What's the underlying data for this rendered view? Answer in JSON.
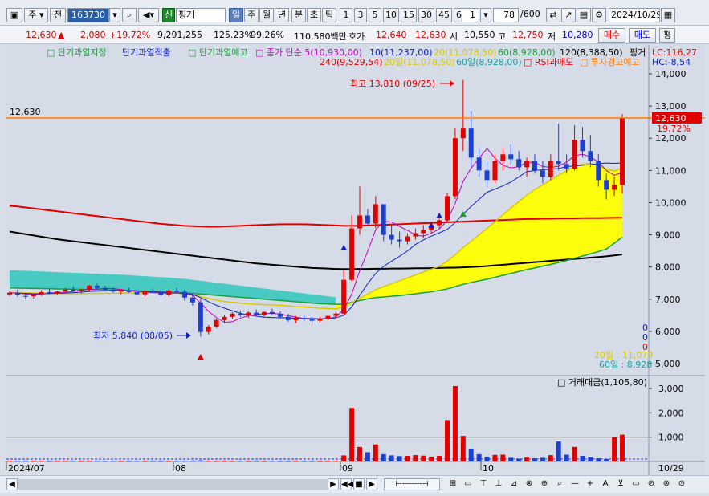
{
  "toolbar": {
    "period_label": "주",
    "prev_label": "전",
    "code": "163730",
    "search_icon": "magnifier",
    "sound_icon": "speaker",
    "new_label": "신",
    "stock_name": "핑거",
    "tf_day": "일",
    "tf_week": "주",
    "tf_month": "월",
    "tf_year": "년",
    "tf_minute": "분",
    "tf_second": "초",
    "tf_tick": "틱",
    "intervals": [
      "1",
      "3",
      "5",
      "10",
      "15",
      "30",
      "45",
      "60"
    ],
    "interval_value": "1",
    "count_value": "78",
    "count_total": "/600",
    "date": "2024/10/29"
  },
  "quote": {
    "price": "12,630",
    "up_arrow": "▲",
    "change": "2,080",
    "change_pct": "+19.72%",
    "volume": "9,291,255",
    "volume_ratio": "125.23%",
    "pct2": "99.26%",
    "amount": "110,580백만",
    "bid_label": "호가",
    "ask_price": "12,640",
    "bid_price": "12,630",
    "open_label": "시",
    "open": "10,550",
    "high_label": "고",
    "high": "12,750",
    "low_label": "저",
    "low": "10,280",
    "buy_label": "매수",
    "sell_label": "매도",
    "eval_label": "평"
  },
  "legend": {
    "l1": "단기과열지정",
    "l2": "단기과열적출",
    "l3": "단기과열예고",
    "l4": "종가 단순 5(10,930,00)",
    "l5": "10(11,237,00)",
    "l6": "20(11,078,50)",
    "l7": "60(8,928,00)",
    "l8": "120(8,388,50)",
    "l9": "핑거",
    "l10": "240(9,529,54)",
    "l11": "20일(11,078,50)",
    "l12": "60일(8,928,00)",
    "l13": "RSI과매도",
    "l14": "투자경고예고",
    "lc": "LC:116,27",
    "hc": "HC:-8,54"
  },
  "annotations": {
    "high": "최고 13,810 (09/25)",
    "low": "최저 5,840 (08/05)",
    "price_line": "12,630",
    "price_tag": "12,630",
    "pct_tag": "19,72%",
    "label_20": "20일 : 11,079",
    "label_60": "60일 : 8,928",
    "zeros": [
      "0",
      "0",
      "0"
    ]
  },
  "price_axis": [
    "14,000",
    "13,000",
    "12,000",
    "11,000",
    "10,000",
    "9,000",
    "8,000",
    "7,000",
    "6,000",
    "5,000"
  ],
  "volume_title": "거래대금(1,105,80)",
  "volume_axis": [
    "3,000",
    "2,000",
    "1,000"
  ],
  "date_axis": [
    "2024/07",
    "08",
    "09",
    "10",
    "10/29"
  ],
  "colors": {
    "up": "#e00000",
    "down": "#1c3fd0",
    "ma240": "#e00000",
    "ma120": "#000000",
    "ma60": "#18a040",
    "ma20": "#f0e000",
    "cloud": "#40c8c0",
    "price_line": "#ff7a00",
    "bg": "#d6dce7"
  },
  "chart_data": {
    "type": "candlestick",
    "candles": [
      [
        7150,
        7250,
        7100,
        7200
      ],
      [
        7200,
        7300,
        7080,
        7120
      ],
      [
        7100,
        7200,
        7000,
        7080
      ],
      [
        7090,
        7180,
        7020,
        7150
      ],
      [
        7150,
        7280,
        7100,
        7220
      ],
      [
        7220,
        7320,
        7150,
        7170
      ],
      [
        7170,
        7260,
        7120,
        7240
      ],
      [
        7240,
        7350,
        7200,
        7300
      ],
      [
        7300,
        7400,
        7220,
        7260
      ],
      [
        7260,
        7330,
        7180,
        7300
      ],
      [
        7300,
        7450,
        7250,
        7420
      ],
      [
        7420,
        7480,
        7300,
        7350
      ],
      [
        7350,
        7420,
        7260,
        7300
      ],
      [
        7300,
        7360,
        7200,
        7240
      ],
      [
        7240,
        7320,
        7150,
        7280
      ],
      [
        7280,
        7350,
        7200,
        7220
      ],
      [
        7220,
        7300,
        7120,
        7150
      ],
      [
        7150,
        7280,
        7100,
        7250
      ],
      [
        7250,
        7330,
        7180,
        7200
      ],
      [
        7200,
        7280,
        7100,
        7120
      ],
      [
        7120,
        7300,
        7080,
        7270
      ],
      [
        7270,
        7350,
        7200,
        7230
      ],
      [
        7230,
        7300,
        6950,
        7050
      ],
      [
        7050,
        7150,
        6800,
        6900
      ],
      [
        6900,
        7000,
        5840,
        5980
      ],
      [
        5980,
        6200,
        5900,
        6150
      ],
      [
        6150,
        6400,
        6100,
        6350
      ],
      [
        6350,
        6500,
        6250,
        6450
      ],
      [
        6450,
        6600,
        6380,
        6550
      ],
      [
        6550,
        6650,
        6450,
        6500
      ],
      [
        6500,
        6620,
        6420,
        6580
      ],
      [
        6580,
        6680,
        6480,
        6520
      ],
      [
        6520,
        6620,
        6450,
        6600
      ],
      [
        6600,
        6700,
        6500,
        6550
      ],
      [
        6550,
        6620,
        6400,
        6450
      ],
      [
        6450,
        6550,
        6300,
        6350
      ],
      [
        6350,
        6480,
        6250,
        6420
      ],
      [
        6420,
        6520,
        6330,
        6380
      ],
      [
        6380,
        6450,
        6280,
        6330
      ],
      [
        6330,
        6460,
        6270,
        6400
      ],
      [
        6400,
        6520,
        6350,
        6480
      ],
      [
        6480,
        6600,
        6420,
        6550
      ],
      [
        6550,
        7900,
        6550,
        7600
      ],
      [
        7600,
        9600,
        7550,
        9200
      ],
      [
        9200,
        10500,
        9000,
        9600
      ],
      [
        9600,
        9800,
        9300,
        9350
      ],
      [
        9350,
        10200,
        9200,
        9950
      ],
      [
        9950,
        9700,
        8800,
        9000
      ],
      [
        9000,
        9300,
        8700,
        8850
      ],
      [
        8850,
        9100,
        8600,
        8800
      ],
      [
        8800,
        9050,
        8700,
        8950
      ],
      [
        8950,
        9200,
        8850,
        9050
      ],
      [
        9050,
        9300,
        8900,
        9150
      ],
      [
        9150,
        9400,
        9050,
        9300
      ],
      [
        9300,
        9500,
        9200,
        9450
      ],
      [
        9450,
        10300,
        9400,
        10200
      ],
      [
        10200,
        12300,
        10100,
        12000
      ],
      [
        12000,
        13810,
        11600,
        12300
      ],
      [
        12300,
        12850,
        11100,
        11400
      ],
      [
        11400,
        11700,
        10800,
        11000
      ],
      [
        11000,
        11300,
        10500,
        10700
      ],
      [
        10700,
        11500,
        10600,
        11300
      ],
      [
        11300,
        11700,
        11000,
        11500
      ],
      [
        11500,
        11800,
        11200,
        11350
      ],
      [
        11350,
        11600,
        11000,
        11100
      ],
      [
        11100,
        11400,
        10800,
        11300
      ],
      [
        11300,
        11500,
        10900,
        11000
      ],
      [
        11000,
        11300,
        10600,
        10800
      ],
      [
        10800,
        11500,
        10700,
        11300
      ],
      [
        11300,
        12450,
        11000,
        11200
      ],
      [
        11200,
        11500,
        10900,
        11050
      ],
      [
        11050,
        12400,
        11000,
        11950
      ],
      [
        11950,
        12350,
        11400,
        11600
      ],
      [
        11600,
        12100,
        11100,
        11300
      ],
      [
        11300,
        11500,
        10500,
        10700
      ],
      [
        10700,
        10900,
        10100,
        10400
      ],
      [
        10400,
        10800,
        10200,
        10550
      ],
      [
        10550,
        12750,
        10280,
        12630
      ]
    ],
    "turnover": [
      30,
      25,
      28,
      22,
      25,
      20,
      22,
      24,
      26,
      21,
      23,
      27,
      22,
      25,
      21,
      19,
      24,
      20,
      23,
      22,
      21,
      25,
      30,
      28,
      45,
      26,
      22,
      24,
      21,
      23,
      20,
      22,
      19,
      24,
      21,
      20,
      25,
      22,
      19,
      20,
      23,
      26,
      250,
      2200,
      600,
      380,
      700,
      300,
      250,
      220,
      230,
      260,
      240,
      200,
      230,
      1700,
      3100,
      1050,
      500,
      300,
      200,
      270,
      280,
      150,
      120,
      160,
      130,
      150,
      260,
      820,
      280,
      600,
      230,
      180,
      130,
      100,
      1000,
      1100
    ],
    "ma240": [
      9900,
      9880,
      9850,
      9820,
      9790,
      9760,
      9730,
      9700,
      9670,
      9640,
      9610,
      9580,
      9550,
      9520,
      9490,
      9460,
      9430,
      9400,
      9370,
      9340,
      9320,
      9300,
      9280,
      9270,
      9260,
      9250,
      9250,
      9260,
      9270,
      9280,
      9290,
      9300,
      9310,
      9320,
      9330,
      9330,
      9330,
      9330,
      9320,
      9310,
      9300,
      9290,
      9280,
      9280,
      9280,
      9290,
      9300,
      9310,
      9320,
      9330,
      9340,
      9350,
      9360,
      9370,
      9380,
      9390,
      9400,
      9410,
      9420,
      9430,
      9440,
      9450,
      9460,
      9470,
      9480,
      9490,
      9490,
      9500,
      9500,
      9510,
      9510,
      9510,
      9520,
      9520,
      9520,
      9525,
      9528,
      9530
    ],
    "ma120": [
      9100,
      9060,
      9020,
      8980,
      8940,
      8900,
      8860,
      8830,
      8800,
      8770,
      8740,
      8710,
      8680,
      8650,
      8620,
      8590,
      8560,
      8530,
      8500,
      8470,
      8440,
      8410,
      8380,
      8350,
      8320,
      8290,
      8260,
      8230,
      8200,
      8170,
      8140,
      8110,
      8090,
      8070,
      8050,
      8030,
      8010,
      7990,
      7970,
      7960,
      7950,
      7940,
      7935,
      7935,
      7940,
      7940,
      7945,
      7945,
      7950,
      7950,
      7955,
      7960,
      7960,
      7965,
      7970,
      7975,
      7980,
      7990,
      8000,
      8010,
      8030,
      8050,
      8070,
      8090,
      8110,
      8130,
      8150,
      8170,
      8190,
      8210,
      8230,
      8250,
      8270,
      8290,
      8310,
      8330,
      8360,
      8390
    ],
    "ma60": [
      7350,
      7345,
      7340,
      7335,
      7330,
      7325,
      7320,
      7315,
      7310,
      7305,
      7300,
      7295,
      7290,
      7285,
      7280,
      7270,
      7260,
      7250,
      7240,
      7230,
      7220,
      7210,
      7200,
      7180,
      7160,
      7140,
      7120,
      7100,
      7080,
      7060,
      7040,
      7020,
      7000,
      6980,
      6960,
      6940,
      6920,
      6900,
      6880,
      6860,
      6850,
      6840,
      6850,
      6900,
      6960,
      7010,
      7050,
      7070,
      7090,
      7110,
      7140,
      7170,
      7200,
      7230,
      7270,
      7320,
      7390,
      7460,
      7520,
      7570,
      7620,
      7680,
      7740,
      7800,
      7860,
      7920,
      7970,
      8030,
      8080,
      8140,
      8200,
      8270,
      8340,
      8410,
      8480,
      8560,
      8740,
      8928
    ],
    "ma20": [
      7200,
      7200,
      7190,
      7190,
      7180,
      7180,
      7175,
      7175,
      7170,
      7170,
      7175,
      7180,
      7180,
      7185,
      7190,
      7190,
      7195,
      7200,
      7200,
      7200,
      7195,
      7190,
      7170,
      7140,
      7080,
      7020,
      6970,
      6930,
      6900,
      6880,
      6860,
      6840,
      6830,
      6820,
      6810,
      6790,
      6770,
      6760,
      6740,
      6720,
      6710,
      6700,
      6760,
      6890,
      7030,
      7160,
      7290,
      7390,
      7480,
      7570,
      7660,
      7750,
      7840,
      7930,
      8020,
      8180,
      8380,
      8600,
      8800,
      9000,
      9200,
      9400,
      9620,
      9830,
      10030,
      10230,
      10400,
      10550,
      10700,
      10850,
      10990,
      11120,
      11200,
      11220,
      11150,
      11050,
      10980,
      11078
    ],
    "ma5": [
      7200,
      7190,
      7160,
      7140,
      7160,
      7190,
      7210,
      7220,
      7240,
      7280,
      7300,
      7320,
      7330,
      7330,
      7300,
      7270,
      7240,
      7220,
      7210,
      7190,
      7180,
      7190,
      7170,
      7120,
      6880,
      6620,
      6430,
      6280,
      6300,
      6410,
      6490,
      6520,
      6550,
      6560,
      6540,
      6490,
      6440,
      6400,
      6380,
      6380,
      6400,
      6450,
      6680,
      7160,
      7880,
      8490,
      9150,
      9420,
      9400,
      9260,
      9140,
      8990,
      8960,
      9050,
      9180,
      9440,
      9980,
      10660,
      11070,
      11380,
      11680,
      11380,
      11160,
      11080,
      11120,
      11250,
      11250,
      11120,
      11100,
      11130,
      11260,
      11460,
      11500,
      11420,
      11260,
      11000,
      10850,
      10930
    ],
    "ma10": [
      7200,
      7190,
      7180,
      7170,
      7170,
      7175,
      7180,
      7190,
      7200,
      7220,
      7240,
      7250,
      7260,
      7270,
      7270,
      7260,
      7250,
      7240,
      7230,
      7220,
      7200,
      7195,
      7180,
      7150,
      7050,
      6920,
      6810,
      6720,
      6640,
      6560,
      6510,
      6470,
      6440,
      6430,
      6420,
      6420,
      6410,
      6400,
      6400,
      6390,
      6400,
      6420,
      6500,
      6760,
      7120,
      7480,
      7800,
      8020,
      8180,
      8330,
      8500,
      8700,
      8840,
      8960,
      9060,
      9170,
      9380,
      9640,
      9880,
      10100,
      10320,
      10420,
      10520,
      10640,
      10800,
      10960,
      11000,
      11020,
      11040,
      11060,
      11120,
      11140,
      11160,
      11180,
      11210,
      11230,
      11220,
      11237
    ],
    "cloud_top": [
      7900,
      7890,
      7880,
      7870,
      7860,
      7850,
      7840,
      7830,
      7820,
      7810,
      7800,
      7790,
      7780,
      7770,
      7760,
      7745,
      7730,
      7715,
      7700,
      7685,
      7670,
      7650,
      7630,
      7600,
      7570,
      7540,
      7510,
      7480,
      7450,
      7420,
      7390,
      7360,
      7330,
      7300,
      7270,
      7240,
      7210,
      7180,
      7150,
      7120,
      7090,
      7060
    ],
    "cloud_bot": [
      7350,
      7345,
      7340,
      7335,
      7330,
      7325,
      7320,
      7315,
      7310,
      7305,
      7300,
      7295,
      7290,
      7285,
      7280,
      7270,
      7260,
      7250,
      7240,
      7230,
      7220,
      7210,
      7200,
      7180,
      7160,
      7140,
      7120,
      7100,
      7080,
      7060,
      7040,
      7020,
      7000,
      6980,
      6960,
      6940,
      6920,
      6900,
      6880,
      6860,
      6850,
      6840
    ]
  }
}
